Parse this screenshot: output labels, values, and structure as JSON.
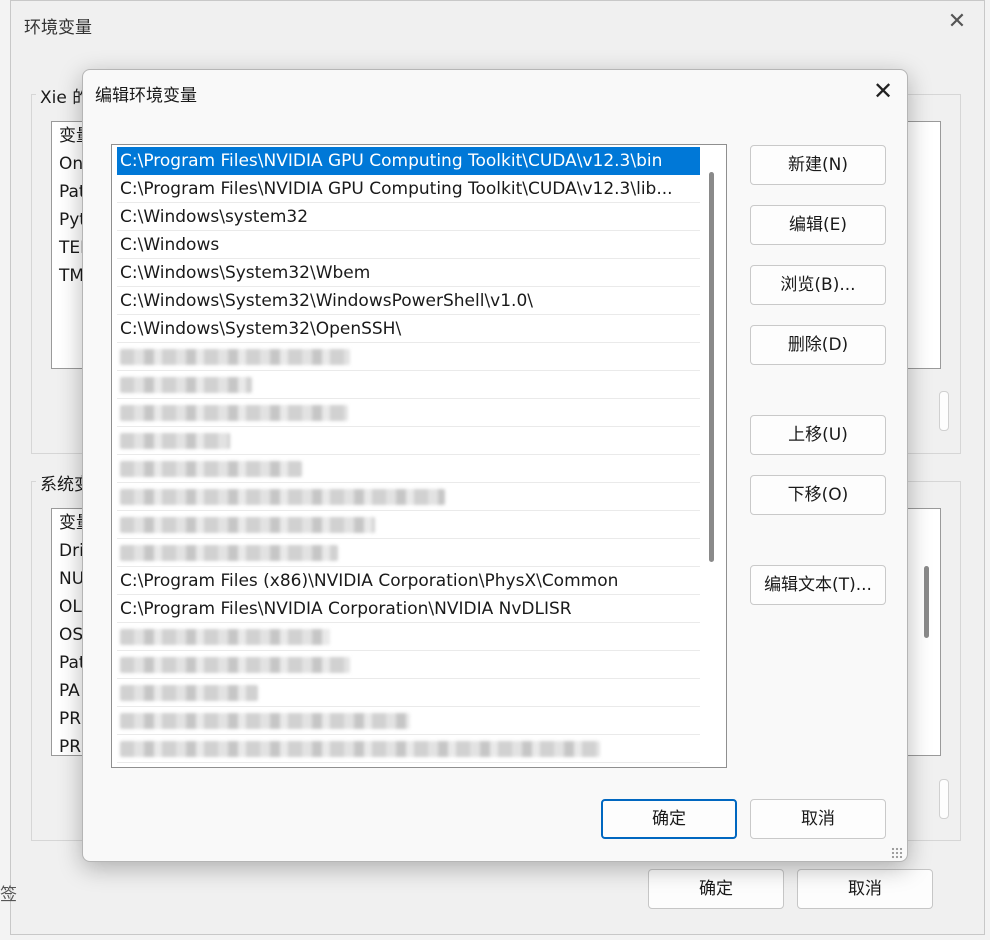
{
  "parent": {
    "title": "环境变量",
    "close_glyph": "✕",
    "user_group_label": "Xie 的",
    "user_rows": [
      "变量",
      "On",
      "Pat",
      "Pyt",
      "TEI",
      "TM"
    ],
    "sys_group_label": "系统变",
    "sys_rows": [
      "变量",
      "Dri",
      "NU",
      "OL",
      "OS",
      "Pat",
      "PA",
      "PR",
      "PR"
    ],
    "left_edge_text": "签",
    "ok_label": "确定",
    "cancel_label": "取消"
  },
  "dialog": {
    "title": "编辑环境变量",
    "close_glyph": "✕",
    "paths": [
      {
        "text": "C:\\Program Files\\NVIDIA GPU Computing Toolkit\\CUDA\\v12.3\\bin",
        "selected": true
      },
      {
        "text": "C:\\Program Files\\NVIDIA GPU Computing Toolkit\\CUDA\\v12.3\\lib..."
      },
      {
        "text": "C:\\Windows\\system32"
      },
      {
        "text": "C:\\Windows"
      },
      {
        "text": "C:\\Windows\\System32\\Wbem"
      },
      {
        "text": "C:\\Windows\\System32\\WindowsPowerShell\\v1.0\\"
      },
      {
        "text": "C:\\Windows\\System32\\OpenSSH\\"
      },
      {
        "text": "",
        "blurred": true
      },
      {
        "text": "",
        "blurred": true
      },
      {
        "text": "",
        "blurred": true
      },
      {
        "text": "",
        "blurred": true
      },
      {
        "text": "",
        "blurred": true
      },
      {
        "text": "",
        "blurred": true
      },
      {
        "text": "",
        "blurred": true
      },
      {
        "text": "",
        "blurred": true
      },
      {
        "text": "C:\\Program Files (x86)\\NVIDIA Corporation\\PhysX\\Common"
      },
      {
        "text": "C:\\Program Files\\NVIDIA Corporation\\NVIDIA NvDLISR"
      },
      {
        "text": "",
        "blurred": true
      },
      {
        "text": "",
        "blurred": true
      },
      {
        "text": "",
        "blurred": true
      },
      {
        "text": "",
        "blurred": true
      },
      {
        "text": "",
        "blurred": true
      }
    ],
    "buttons": {
      "new": "新建(N)",
      "edit": "编辑(E)",
      "browse": "浏览(B)...",
      "delete": "删除(D)",
      "move_up": "上移(U)",
      "move_down": "下移(O)",
      "edit_text": "编辑文本(T)..."
    },
    "ok_label": "确定",
    "cancel_label": "取消"
  },
  "colors": {
    "selection": "#0078d7",
    "default_button_border": "#0067c0"
  }
}
